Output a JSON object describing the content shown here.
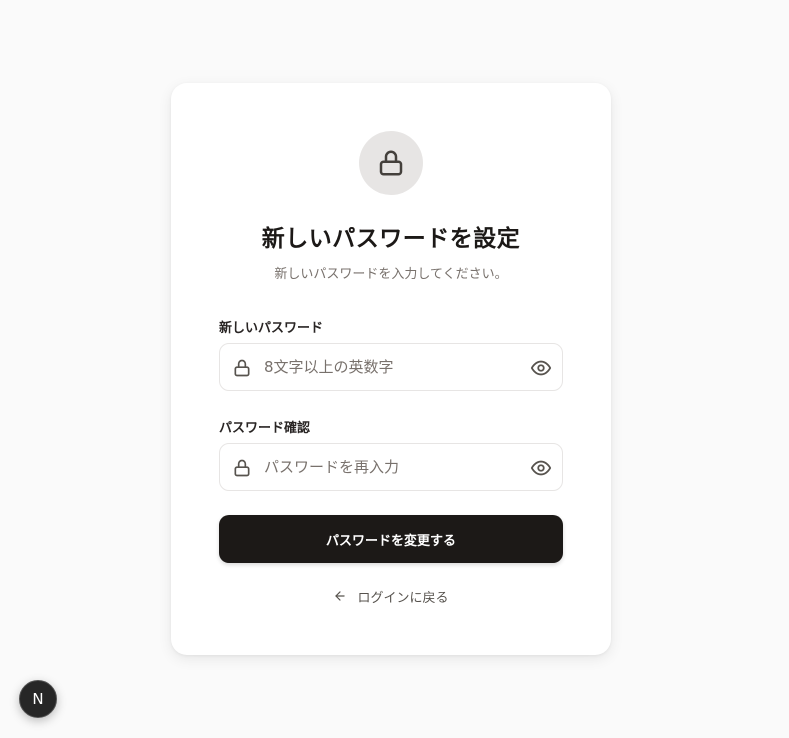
{
  "card": {
    "title": "新しいパスワードを設定",
    "subtitle": "新しいパスワードを入力してください。"
  },
  "form": {
    "new_password": {
      "label": "新しいパスワード",
      "value": "",
      "placeholder": "8文字以上の英数字"
    },
    "confirm_password": {
      "label": "パスワード確認",
      "value": "",
      "placeholder": "パスワードを再入力"
    },
    "submit_label": "パスワードを変更する",
    "back_label": "ログインに戻る"
  },
  "badge": {
    "label": "N"
  },
  "icons": {
    "header": "lock-icon",
    "field": "lock-icon",
    "toggle": "eye-icon",
    "back": "arrow-left-icon"
  },
  "colors": {
    "background": "#fafafa",
    "primary": "#1c1917",
    "muted_text": "#78716c",
    "border": "#e7e5e4",
    "icon_circle": "#e7e5e4"
  }
}
